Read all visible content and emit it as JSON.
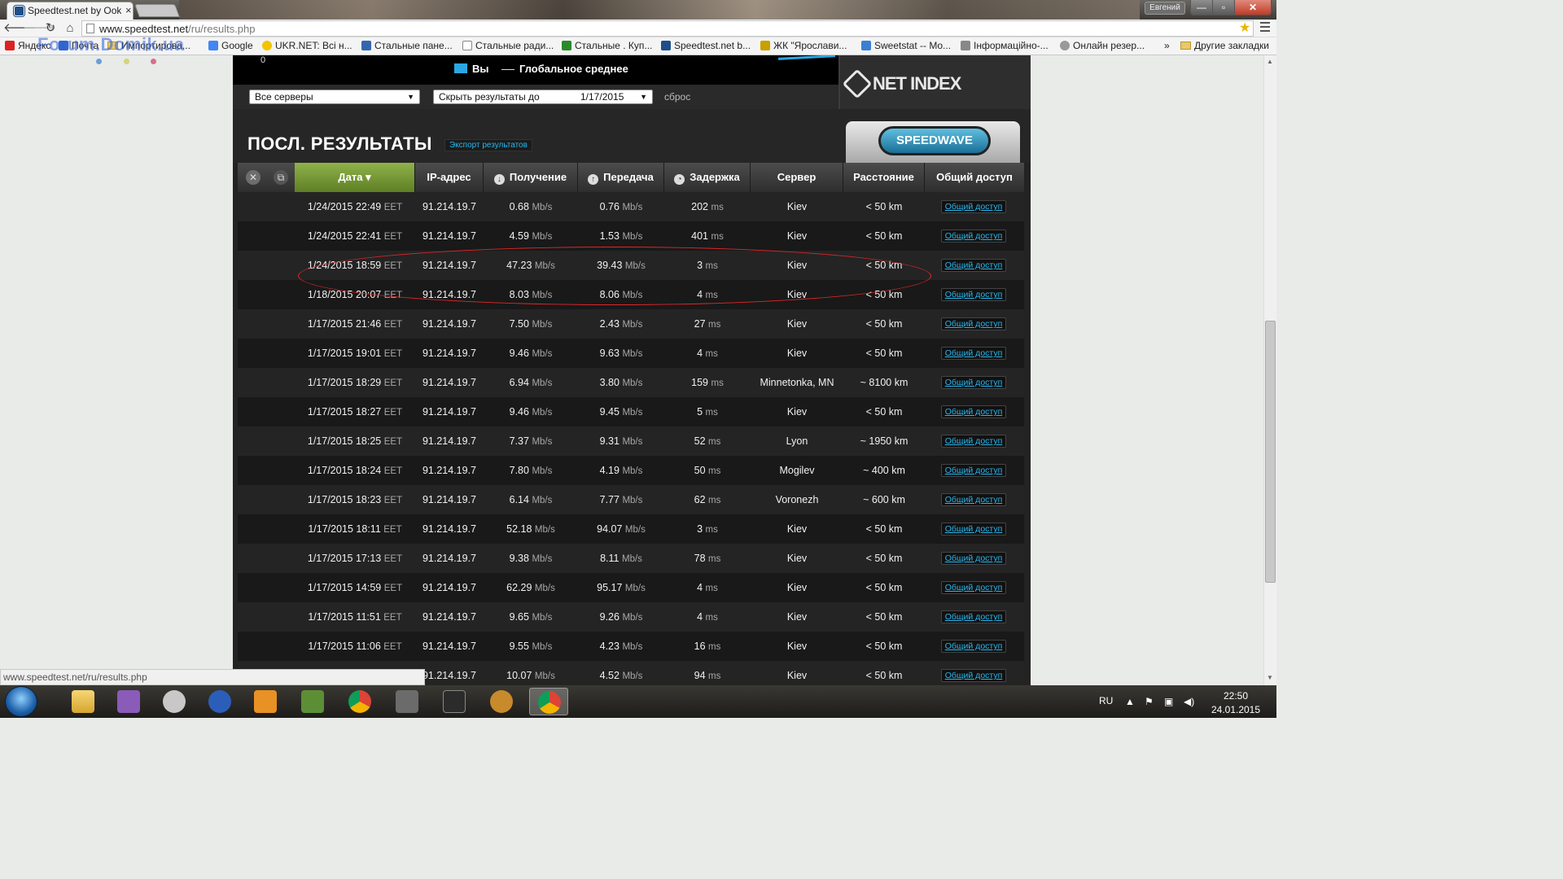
{
  "browser": {
    "tab_title": "Speedtest.net by Ookla",
    "tab_close": "×",
    "profile_name": "Евгений",
    "url_host": "www.speedtest.net",
    "url_path": "/ru/results.php",
    "status_url": "www.speedtest.net/ru/results.php",
    "bookmarks": [
      {
        "label": "Яндекс",
        "icon": "yandex-icon"
      },
      {
        "label": "Почта",
        "icon": "mail-icon"
      },
      {
        "label": "Импортирова...",
        "icon": "folder-icon"
      },
      {
        "label": "Google",
        "icon": "google-icon"
      },
      {
        "label": "UKR.NET: Всі н...",
        "icon": "ukrnet-icon"
      },
      {
        "label": "Стальные пане...",
        "icon": "site-icon"
      },
      {
        "label": "Стальные ради...",
        "icon": "page-icon"
      },
      {
        "label": "Стальные . Куп...",
        "icon": "site-icon"
      },
      {
        "label": "Speedtest.net b...",
        "icon": "speedtest-icon"
      },
      {
        "label": "ЖК \"Ярослави...",
        "icon": "site-icon"
      },
      {
        "label": "Sweetstat -- Mo...",
        "icon": "site-icon"
      },
      {
        "label": "Інформаційно-...",
        "icon": "site-icon"
      },
      {
        "label": "Онлайн резер...",
        "icon": "site-icon"
      }
    ],
    "bookmarks_more": "»",
    "other_bookmarks": "Другие закладки",
    "watermark": "Forum.Domik.ua"
  },
  "graph": {
    "axis_zero": "0",
    "legend_you": "Вы",
    "legend_global": "Глобальное среднее",
    "colors": {
      "you": "#2aa7e3"
    }
  },
  "filters": {
    "servers": "Все серверы",
    "hide_label": "Скрыть результаты до",
    "hide_date": "1/17/2015",
    "reset": "сброс"
  },
  "netindex": {
    "label": "NET INDEX"
  },
  "results": {
    "title": "ПОСЛ. РЕЗУЛЬТАТЫ",
    "export": "Экспорт результатов",
    "speedwave": "SPEEDWAVE",
    "columns": {
      "date": "Дата ▾",
      "ip": "IP-адрес",
      "download": "Получение",
      "upload": "Передача",
      "latency": "Задержка",
      "server": "Сервер",
      "distance": "Расстояние",
      "share": "Общий доступ"
    },
    "share_label": "Общий доступ",
    "tz": "EET",
    "speed_unit": "Mb/s",
    "latency_unit": "ms",
    "rows": [
      {
        "date": "1/24/2015 22:49",
        "ip": "91.214.19.7",
        "down": "0.68",
        "up": "0.76",
        "ping": "202",
        "server": "Kiev",
        "distance": "< 50 km"
      },
      {
        "date": "1/24/2015 22:41",
        "ip": "91.214.19.7",
        "down": "4.59",
        "up": "1.53",
        "ping": "401",
        "server": "Kiev",
        "distance": "< 50 km"
      },
      {
        "date": "1/24/2015 18:59",
        "ip": "91.214.19.7",
        "down": "47.23",
        "up": "39.43",
        "ping": "3",
        "server": "Kiev",
        "distance": "< 50 km"
      },
      {
        "date": "1/18/2015 20:07",
        "ip": "91.214.19.7",
        "down": "8.03",
        "up": "8.06",
        "ping": "4",
        "server": "Kiev",
        "distance": "< 50 km"
      },
      {
        "date": "1/17/2015 21:46",
        "ip": "91.214.19.7",
        "down": "7.50",
        "up": "2.43",
        "ping": "27",
        "server": "Kiev",
        "distance": "< 50 km"
      },
      {
        "date": "1/17/2015 19:01",
        "ip": "91.214.19.7",
        "down": "9.46",
        "up": "9.63",
        "ping": "4",
        "server": "Kiev",
        "distance": "< 50 km"
      },
      {
        "date": "1/17/2015 18:29",
        "ip": "91.214.19.7",
        "down": "6.94",
        "up": "3.80",
        "ping": "159",
        "server": "Minnetonka, MN",
        "distance": "~ 8100 km"
      },
      {
        "date": "1/17/2015 18:27",
        "ip": "91.214.19.7",
        "down": "9.46",
        "up": "9.45",
        "ping": "5",
        "server": "Kiev",
        "distance": "< 50 km"
      },
      {
        "date": "1/17/2015 18:25",
        "ip": "91.214.19.7",
        "down": "7.37",
        "up": "9.31",
        "ping": "52",
        "server": "Lyon",
        "distance": "~ 1950 km"
      },
      {
        "date": "1/17/2015 18:24",
        "ip": "91.214.19.7",
        "down": "7.80",
        "up": "4.19",
        "ping": "50",
        "server": "Mogilev",
        "distance": "~ 400 km"
      },
      {
        "date": "1/17/2015 18:23",
        "ip": "91.214.19.7",
        "down": "6.14",
        "up": "7.77",
        "ping": "62",
        "server": "Voronezh",
        "distance": "~ 600 km"
      },
      {
        "date": "1/17/2015 18:11",
        "ip": "91.214.19.7",
        "down": "52.18",
        "up": "94.07",
        "ping": "3",
        "server": "Kiev",
        "distance": "< 50 km"
      },
      {
        "date": "1/17/2015 17:13",
        "ip": "91.214.19.7",
        "down": "9.38",
        "up": "8.11",
        "ping": "78",
        "server": "Kiev",
        "distance": "< 50 km"
      },
      {
        "date": "1/17/2015 14:59",
        "ip": "91.214.19.7",
        "down": "62.29",
        "up": "95.17",
        "ping": "4",
        "server": "Kiev",
        "distance": "< 50 km"
      },
      {
        "date": "1/17/2015 11:51",
        "ip": "91.214.19.7",
        "down": "9.65",
        "up": "9.26",
        "ping": "4",
        "server": "Kiev",
        "distance": "< 50 km"
      },
      {
        "date": "1/17/2015 11:06",
        "ip": "91.214.19.7",
        "down": "9.55",
        "up": "4.23",
        "ping": "16",
        "server": "Kiev",
        "distance": "< 50 km"
      },
      {
        "date": "",
        "ip": "91.214.19.7",
        "down": "10.07",
        "up": "4.52",
        "ping": "94",
        "server": "Kiev",
        "distance": "< 50 km"
      }
    ]
  },
  "taskbar": {
    "apps": [
      "explorer-icon",
      "visual-studio-icon",
      "radio-icon",
      "kiev-icon",
      "media-player-icon",
      "minecraft-icon",
      "chrome-icon",
      "world-of-tanks-icon",
      "battlefield-icon",
      "game-icon",
      "chrome-icon"
    ],
    "lang": "RU",
    "time": "22:50",
    "date": "24.01.2015"
  }
}
